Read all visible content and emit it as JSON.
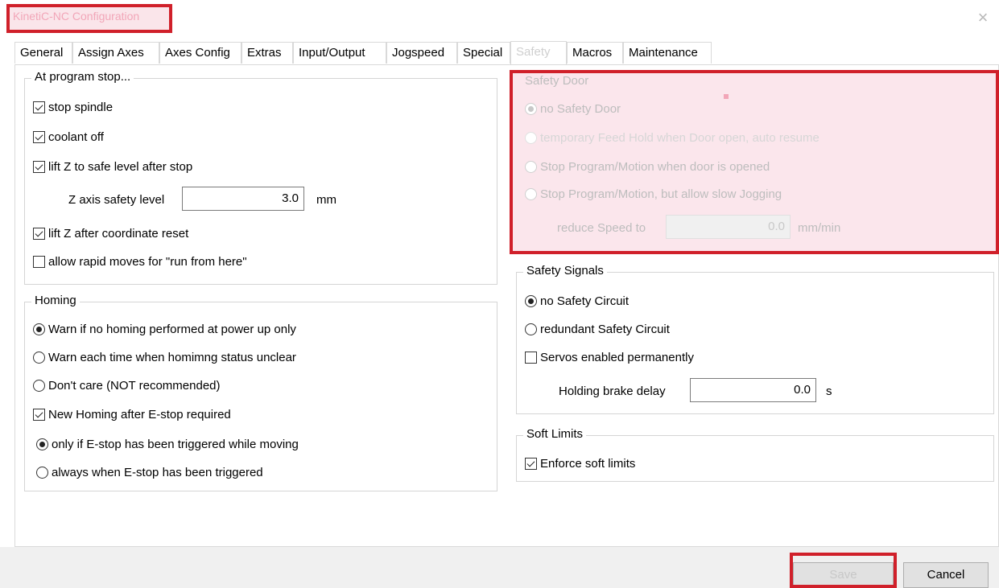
{
  "window": {
    "title": "KinetiC-NC Configuration",
    "close_glyph": "×"
  },
  "tabs": [
    {
      "label": "General"
    },
    {
      "label": "Assign Axes"
    },
    {
      "label": "Axes Config"
    },
    {
      "label": "Extras"
    },
    {
      "label": "Input/Output"
    },
    {
      "label": "Jogspeed"
    },
    {
      "label": "Special"
    },
    {
      "label": "Safety",
      "active": true
    },
    {
      "label": "Macros"
    },
    {
      "label": "Maintenance"
    }
  ],
  "program_stop": {
    "title": "At program stop...",
    "stop_spindle": "stop spindle",
    "coolant_off": "coolant off",
    "lift_z": "lift Z to safe level after stop",
    "z_safety_label": "Z axis safety level",
    "z_safety_value": "3.0",
    "z_safety_unit": "mm",
    "lift_z_reset": "lift Z after coordinate reset",
    "allow_rapid": "allow rapid moves for \"run from here\""
  },
  "homing": {
    "title": "Homing",
    "warn_power_up": "Warn if no homing performed at power up only",
    "warn_each_time": "Warn each time when homimng status unclear",
    "dont_care": "Don't care (NOT recommended)",
    "new_homing": "New Homing after E-stop required",
    "only_if_moving": "only if E-stop has been triggered while moving",
    "always": "always when E-stop has been triggered"
  },
  "safety_door": {
    "title": "Safety Door",
    "no_door": "no Safety Door",
    "temp_feed_hold": "temporary Feed Hold when Door open, auto resume",
    "stop_program": "Stop Program/Motion when door is opened",
    "stop_allow_jog": "Stop Program/Motion, but allow slow Jogging",
    "reduce_speed_label": "reduce Speed to",
    "reduce_speed_value": "0.0",
    "reduce_speed_unit": "mm/min"
  },
  "safety_signals": {
    "title": "Safety Signals",
    "no_circuit": "no Safety Circuit",
    "redundant": "redundant Safety Circuit",
    "servos": "Servos enabled permanently",
    "brake_label": "Holding brake delay",
    "brake_value": "0.0",
    "brake_unit": "s"
  },
  "soft_limits": {
    "title": "Soft Limits",
    "enforce": "Enforce soft limits"
  },
  "buttons": {
    "save": "Save",
    "cancel": "Cancel"
  },
  "colors": {
    "highlight_border": "#d0202a",
    "highlight_fill": "#f8d2dc"
  }
}
